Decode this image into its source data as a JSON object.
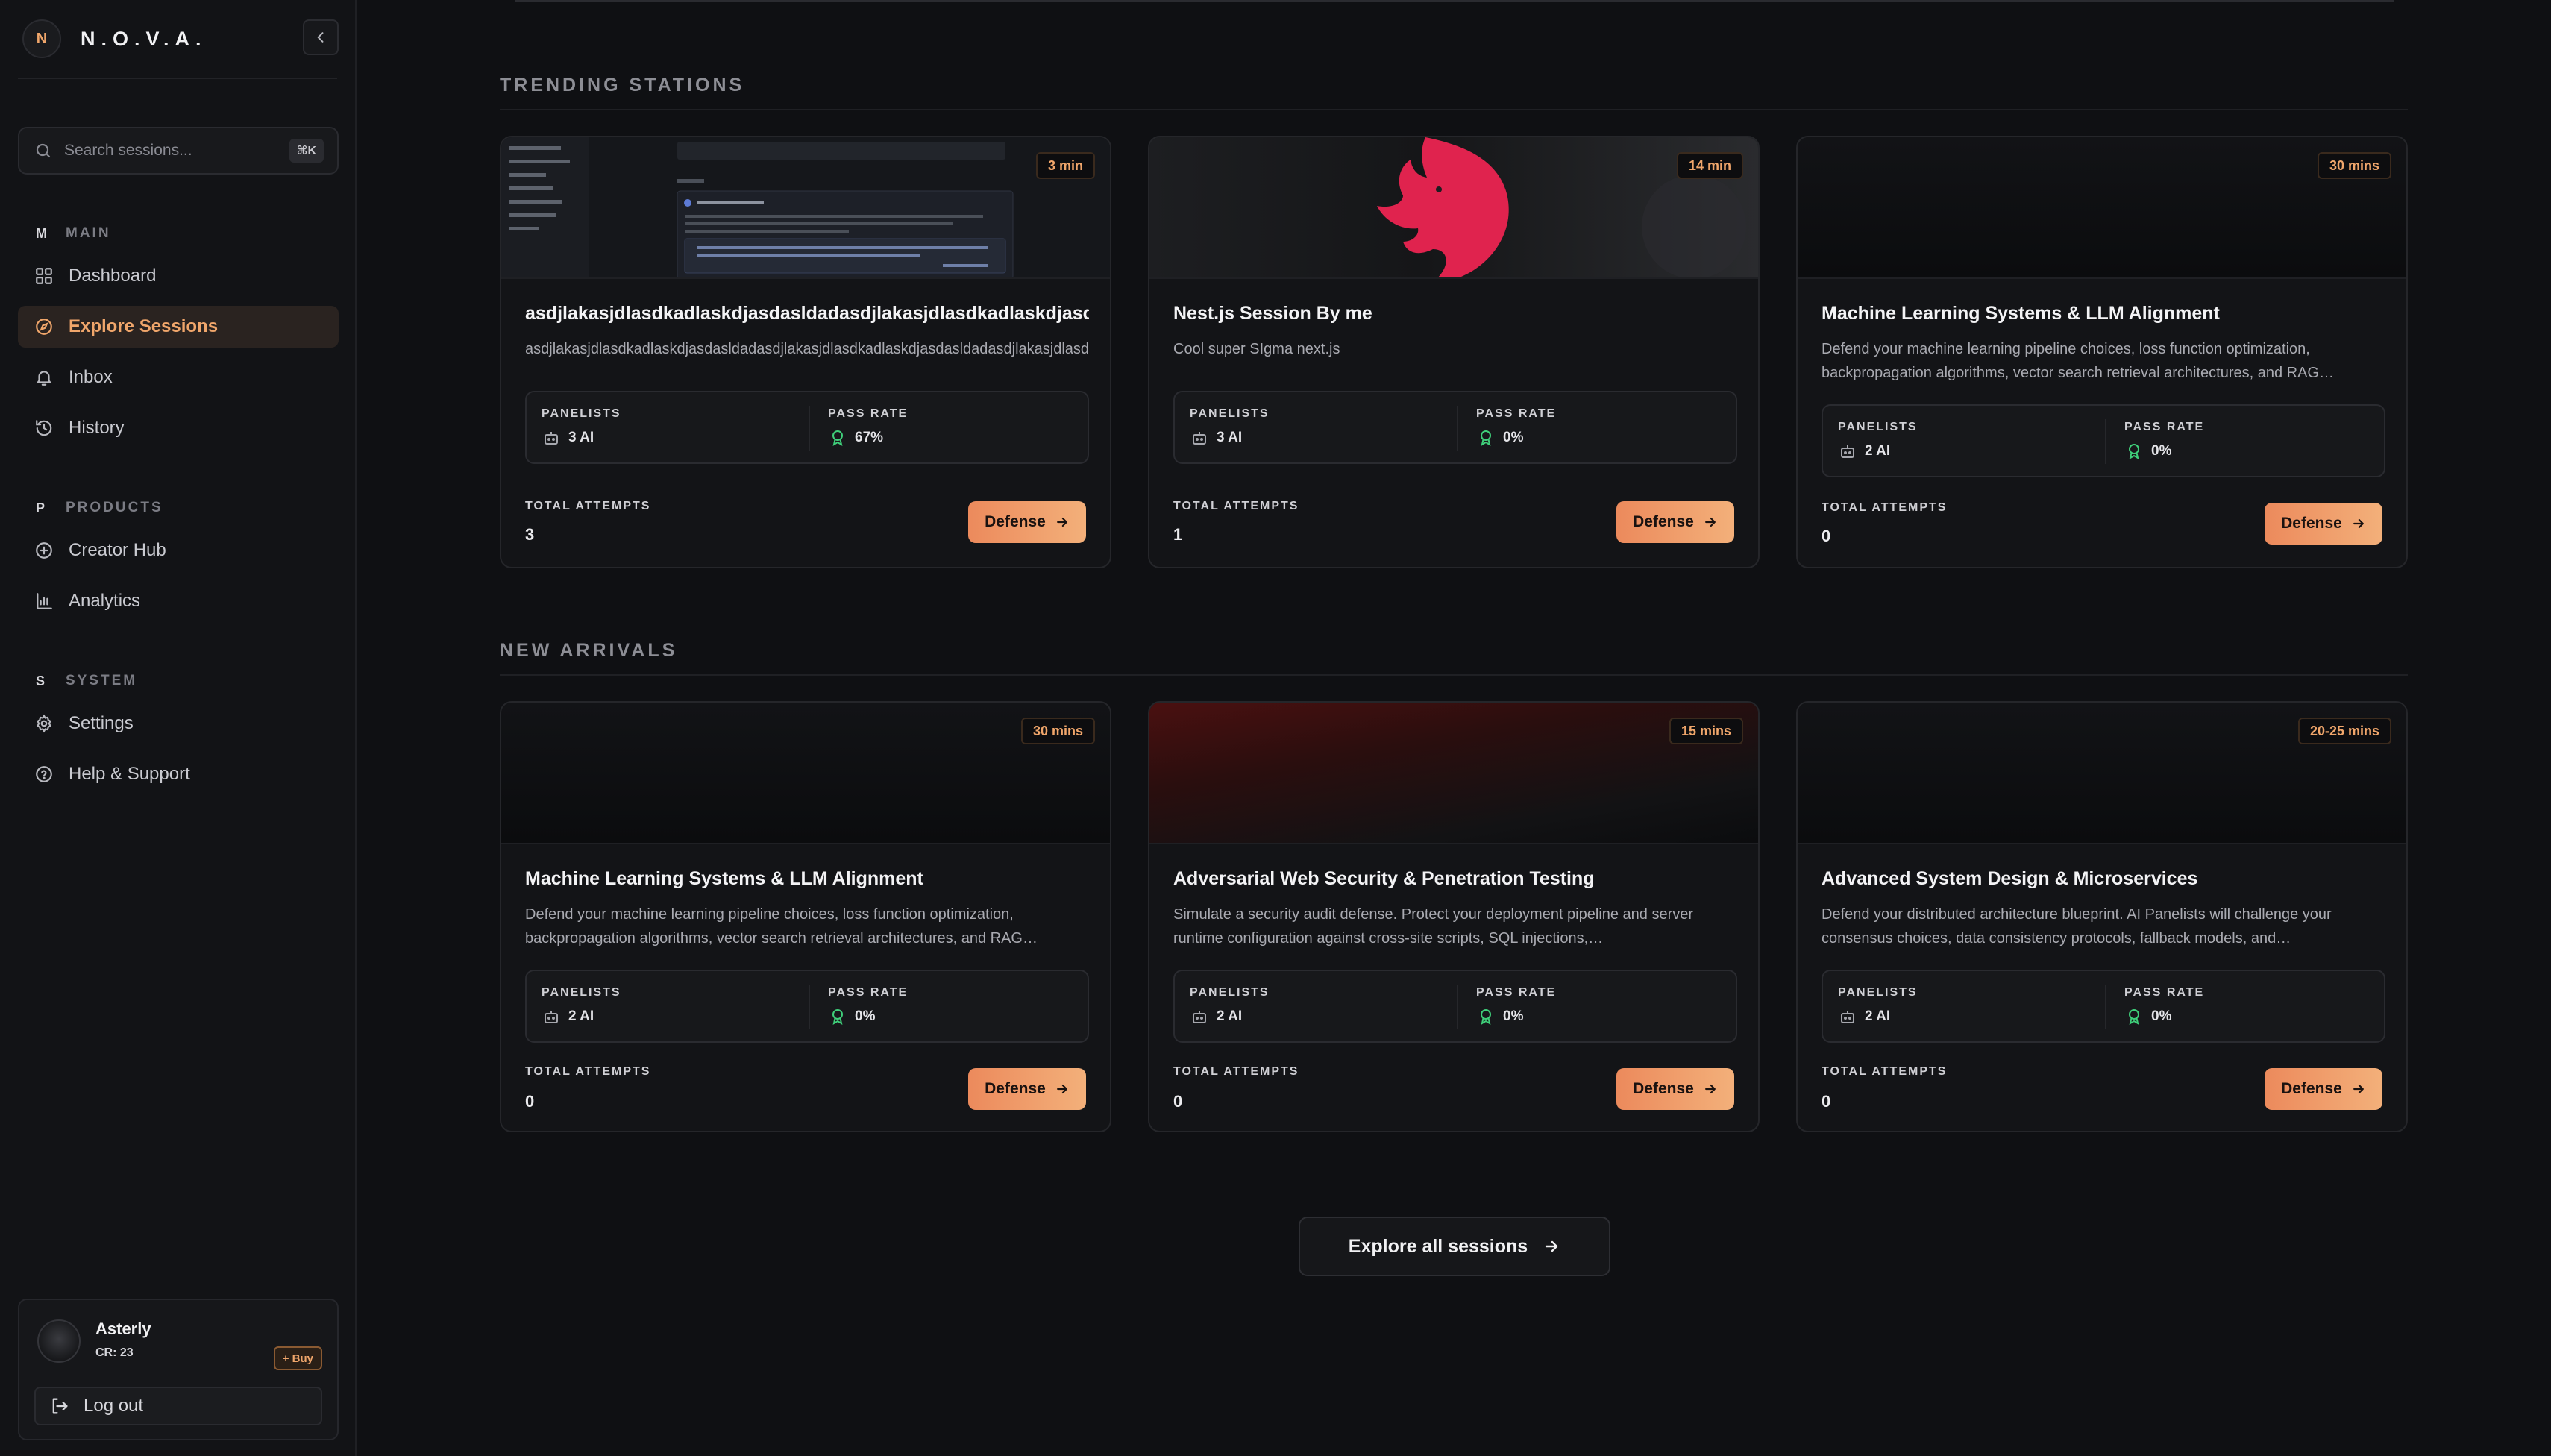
{
  "app": {
    "logo_letter": "N",
    "name": "N.O.V.A."
  },
  "search": {
    "placeholder": "Search sessions...",
    "shortcut": "⌘K"
  },
  "nav": {
    "main": {
      "letter": "M",
      "label": "MAIN",
      "items": [
        {
          "label": "Dashboard",
          "icon": "grid-icon"
        },
        {
          "label": "Explore Sessions",
          "icon": "compass-icon",
          "active": true
        },
        {
          "label": "Inbox",
          "icon": "bell-icon"
        },
        {
          "label": "History",
          "icon": "history-icon"
        }
      ]
    },
    "products": {
      "letter": "P",
      "label": "PRODUCTS",
      "items": [
        {
          "label": "Creator Hub",
          "icon": "plus-circle-icon"
        },
        {
          "label": "Analytics",
          "icon": "bar-chart-icon"
        }
      ]
    },
    "system": {
      "letter": "S",
      "label": "SYSTEM",
      "items": [
        {
          "label": "Settings",
          "icon": "gear-icon"
        },
        {
          "label": "Help & Support",
          "icon": "help-circle-icon"
        }
      ]
    }
  },
  "user": {
    "name": "Asterly",
    "credits": "CR: 23",
    "buy_label": "+ Buy",
    "logout_label": "Log out"
  },
  "labels": {
    "panelists": "PANELISTS",
    "pass_rate": "PASS RATE",
    "total_attempts": "TOTAL ATTEMPTS",
    "defense": "Defense"
  },
  "trending": {
    "title": "TRENDING STATIONS",
    "cards": [
      {
        "duration": "3 min",
        "title": "asdjlakasjdlasdkadlaskdjasdasldadasdjlakasjdlasdkadlaskdjasdasldadasdjlakas",
        "desc": "asdjlakasjdlasdkadlaskdjasdasldadasdjlakasjdlasdkadlaskdjasdasldadasdjlakasjdlasdkadlaskdjasdasldadasd",
        "panelists": "3 AI",
        "pass_rate": "67%",
        "attempts": "3"
      },
      {
        "duration": "14 min",
        "title": "Nest.js Session By me",
        "desc": "Cool super SIgma next.js",
        "panelists": "3 AI",
        "pass_rate": "0%",
        "attempts": "1"
      },
      {
        "duration": "30 mins",
        "title": "Machine Learning Systems & LLM Alignment",
        "desc": "Defend your machine learning pipeline choices, loss function optimization, backpropagation algorithms, vector search retrieval architectures, and RAG…",
        "panelists": "2 AI",
        "pass_rate": "0%",
        "attempts": "0"
      }
    ]
  },
  "arrivals": {
    "title": "NEW ARRIVALS",
    "cards": [
      {
        "duration": "30 mins",
        "title": "Machine Learning Systems & LLM Alignment",
        "desc": "Defend your machine learning pipeline choices, loss function optimization, backpropagation algorithms, vector search retrieval architectures, and RAG…",
        "panelists": "2 AI",
        "pass_rate": "0%",
        "attempts": "0"
      },
      {
        "duration": "15 mins",
        "title": "Adversarial Web Security & Penetration Testing",
        "desc": "Simulate a security audit defense. Protect your deployment pipeline and server runtime configuration against cross-site scripts, SQL injections,…",
        "panelists": "2 AI",
        "pass_rate": "0%",
        "attempts": "0"
      },
      {
        "duration": "20-25 mins",
        "title": "Advanced System Design & Microservices",
        "desc": "Defend your distributed architecture blueprint. AI Panelists will challenge your consensus choices, data consistency protocols, fallback models, and…",
        "panelists": "2 AI",
        "pass_rate": "0%",
        "attempts": "0"
      }
    ]
  },
  "explore_all_label": "Explore all sessions",
  "colors": {
    "accent": "#f0a66b",
    "button_start": "#ec8a5c",
    "button_end": "#f3b07a",
    "success": "#3fcf7a",
    "background": "#0f1013"
  }
}
